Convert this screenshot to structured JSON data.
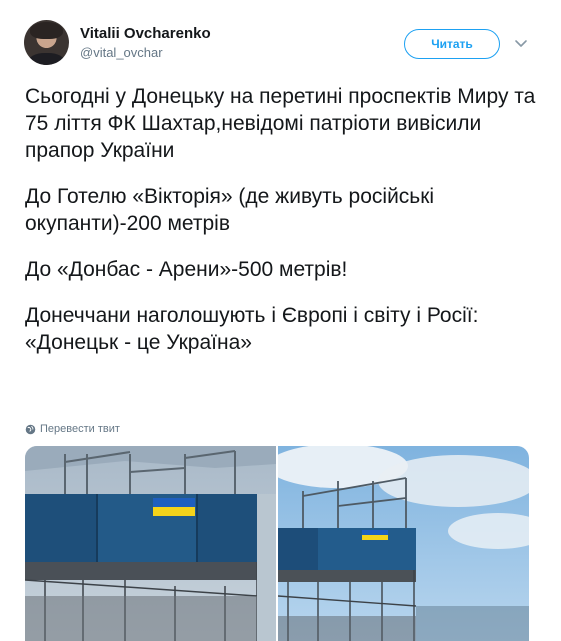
{
  "author": {
    "name": "Vitalii Ovcharenko",
    "handle": "@vital_ovchar"
  },
  "actions": {
    "follow_label": "Читать"
  },
  "tweet": {
    "paragraphs": [
      "Сьогодні у Донецьку на перетині проспектів Миру та 75 ліття ФК Шахтар,невідомі патріоти вивісили прапор України",
      "До Готелю «Вікторія» (де живуть російські окупанти)-200 метрів",
      "До «Донбас - Арени»-500 метрів!",
      "Донеччани наголошують і Європі і світу і Росії: «Донецьк - це Україна»"
    ],
    "translate_label": "Перевести твит"
  },
  "media": {
    "photos": [
      {
        "subject": "building-with-ukrainian-flag"
      },
      {
        "subject": "building-with-ukrainian-flag-wide"
      }
    ]
  },
  "colors": {
    "accent": "#1da1f2",
    "text": "#14171a",
    "secondary": "#657786",
    "flag_blue": "#1f5fbf",
    "flag_yellow": "#f5d31a"
  }
}
